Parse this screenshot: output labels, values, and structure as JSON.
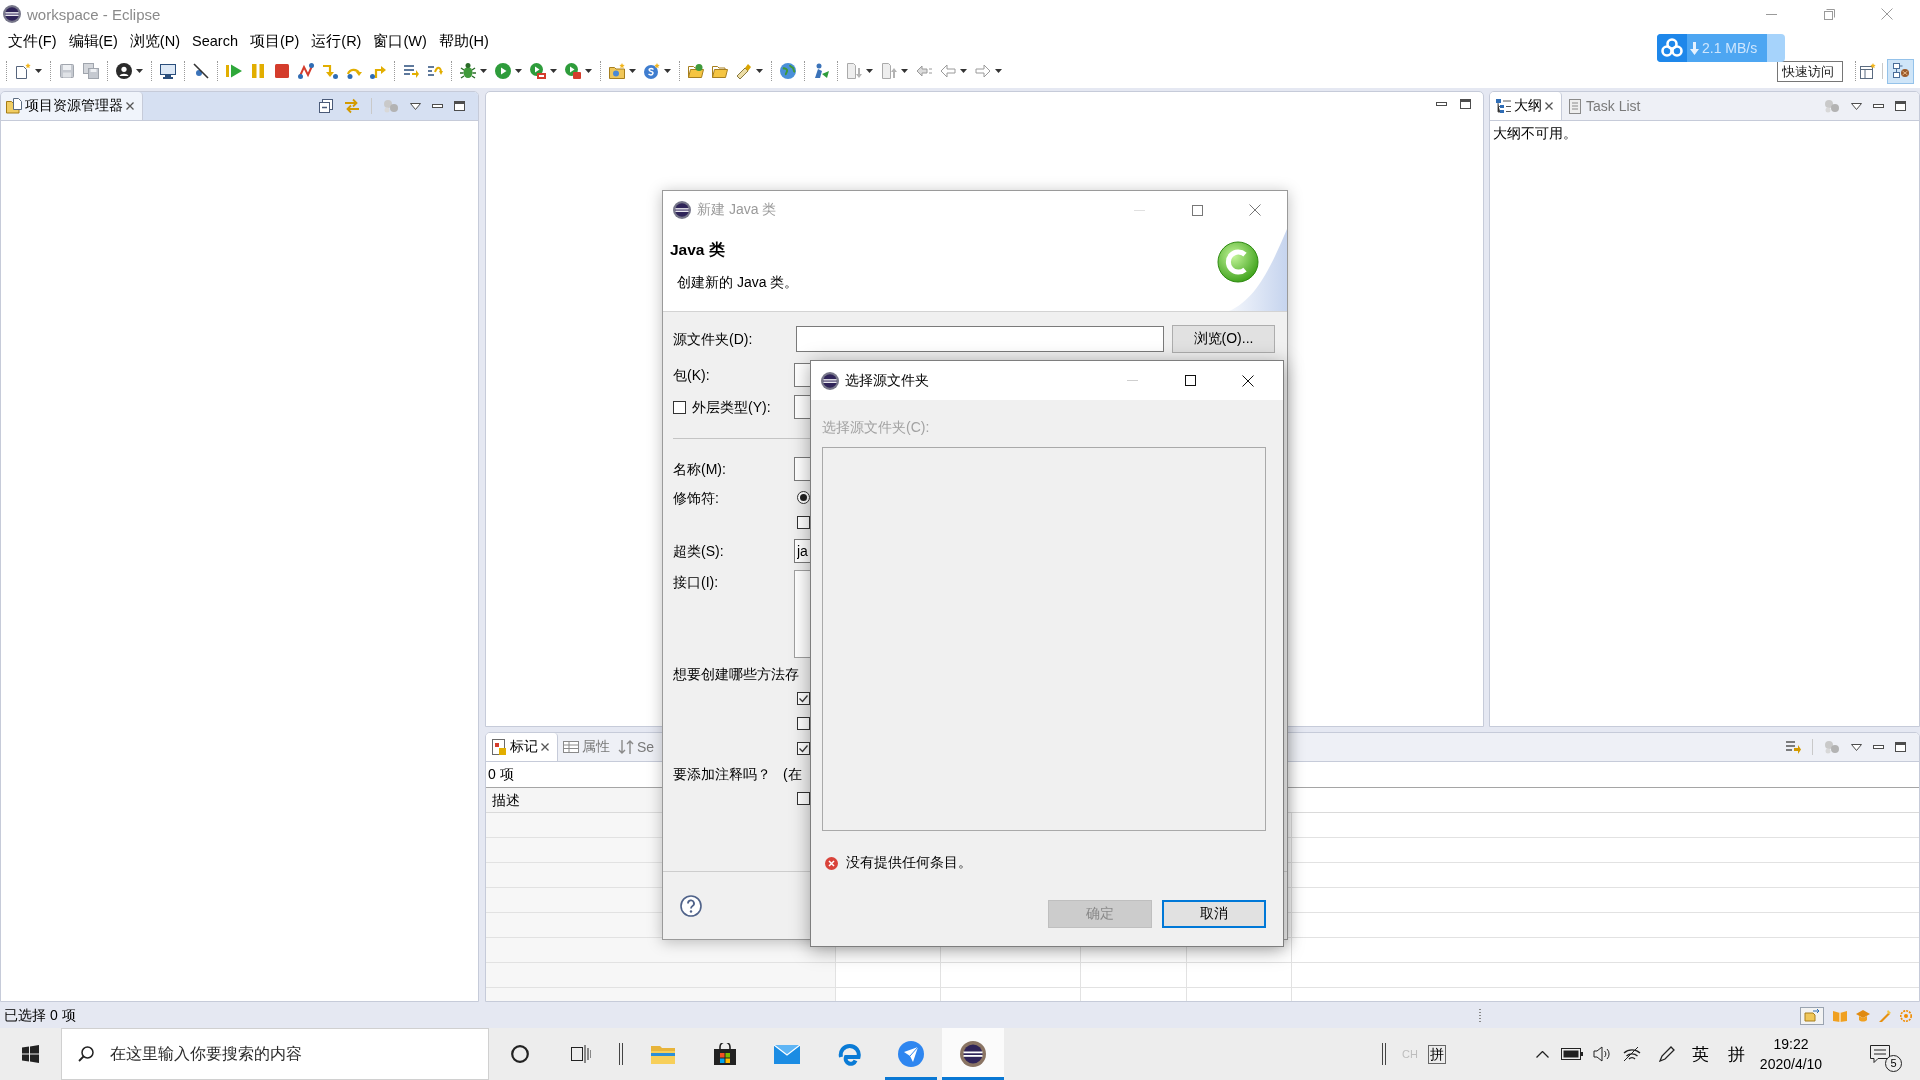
{
  "window": {
    "title": "workspace - Eclipse",
    "active": false
  },
  "menu": [
    "文件(F)",
    "编辑(E)",
    "浏览(N)",
    "Search",
    "项目(P)",
    "运行(R)",
    "窗口(W)",
    "帮助(H)"
  ],
  "download_widget": {
    "speed": "2.1 MB/s"
  },
  "quick_access": {
    "placeholder": "快速访问"
  },
  "perspectives": [
    {
      "selected": true
    }
  ],
  "project_explorer": {
    "active": true,
    "tabs": [
      {
        "label": "项目资源管理器",
        "selected": true
      }
    ]
  },
  "outline": {
    "active": false,
    "tabs": [
      {
        "label": "大纲",
        "selected": true
      },
      {
        "label": "Task List",
        "selected": false
      }
    ],
    "message": "大纲不可用。"
  },
  "markers": {
    "active": false,
    "tabs": [
      {
        "label": "标记",
        "selected": true
      },
      {
        "label": "属性",
        "selected": false
      },
      {
        "label": "Se",
        "selected": false
      }
    ],
    "count": "0 项",
    "columns": [
      "描述"
    ]
  },
  "status_bar": {
    "text": "已选择 0 项"
  },
  "new_class_dialog": {
    "title": "新建 Java 类",
    "active": false,
    "heading": "Java 类",
    "description": "创建新的 Java 类。",
    "rows": [
      {
        "kind": "path",
        "label": "源文件夹(D):",
        "button": "浏览(O)..."
      },
      {
        "kind": "field",
        "label": "包(K):"
      },
      {
        "kind": "check_field",
        "label": "外层类型(Y):",
        "checked": false
      },
      {
        "kind": "separator"
      },
      {
        "kind": "field",
        "label": "名称(M):"
      },
      {
        "kind": "radio",
        "label": "修饰符:",
        "selected": true
      },
      {
        "kind": "check",
        "checked": false
      },
      {
        "kind": "field",
        "label": "超类(S):",
        "value": "ja"
      },
      {
        "kind": "list",
        "label": "接口(I):"
      },
      {
        "kind": "text",
        "label": "想要创建哪些方法存"
      },
      {
        "kind": "check",
        "checked": true
      },
      {
        "kind": "check",
        "checked": false
      },
      {
        "kind": "check",
        "checked": true
      },
      {
        "kind": "text",
        "label": "要添加注释吗？",
        "note": "(在"
      },
      {
        "kind": "check",
        "checked": false
      }
    ]
  },
  "source_folder_dialog": {
    "title": "选择源文件夹",
    "active": true,
    "label": "选择源文件夹(C):",
    "label_disabled": true,
    "error": "没有提供任何条目。",
    "buttons": [
      {
        "label": "确定",
        "disabled": true,
        "focused": false
      },
      {
        "label": "取消",
        "disabled": false,
        "focused": true
      }
    ]
  },
  "taskbar": {
    "search_placeholder": "在这里输入你要搜索的内容",
    "apps": [
      {
        "running": false,
        "active": false
      },
      {
        "running": false,
        "active": false
      },
      {
        "running": false,
        "active": false
      },
      {
        "running": false,
        "active": false
      },
      {
        "running": true,
        "active": false
      },
      {
        "running": true,
        "active": true
      }
    ],
    "language_bar": {
      "language": "CH",
      "mode": "拼"
    },
    "input_language": "英",
    "input_mode": "拼",
    "time": "19:22",
    "date": "2020/4/10",
    "notifications": "5"
  }
}
